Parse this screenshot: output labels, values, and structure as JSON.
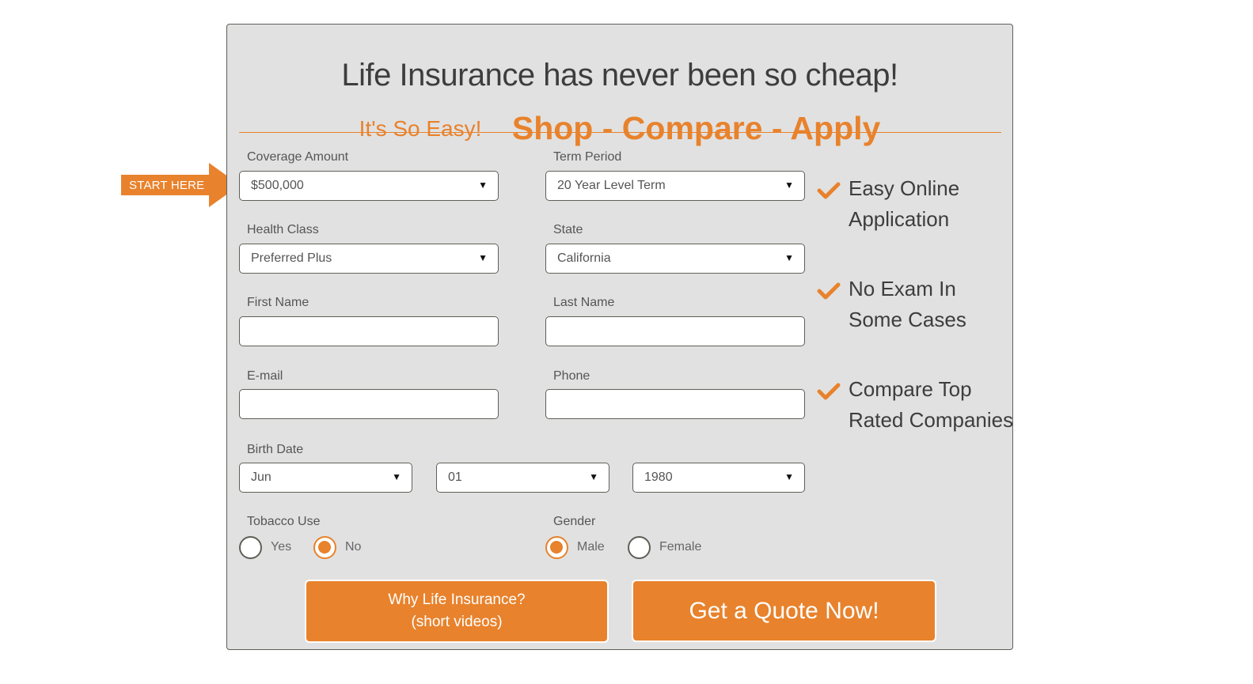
{
  "header": {
    "title": "Life Insurance has never been so cheap!",
    "tagline": "It's So Easy!",
    "steps": "Shop - Compare - Apply"
  },
  "callout": {
    "label": "START HERE",
    "icon": "arrow-right-icon"
  },
  "form": {
    "coverage": {
      "label": "Coverage Amount",
      "value": "$500,000"
    },
    "term": {
      "label": "Term Period",
      "value": "20 Year Level Term"
    },
    "health": {
      "label": "Health Class",
      "value": "Preferred Plus"
    },
    "state": {
      "label": "State",
      "value": "California"
    },
    "first_name": {
      "label": "First Name",
      "value": ""
    },
    "last_name": {
      "label": "Last Name",
      "value": ""
    },
    "email": {
      "label": "E-mail",
      "value": ""
    },
    "phone": {
      "label": "Phone",
      "value": ""
    },
    "birth_date": {
      "label": "Birth Date",
      "month": "Jun",
      "day": "01",
      "year": "1980"
    },
    "tobacco": {
      "label": "Tobacco Use",
      "options": [
        {
          "label": "Yes",
          "checked": false
        },
        {
          "label": "No",
          "checked": true
        }
      ]
    },
    "gender": {
      "label": "Gender",
      "options": [
        {
          "label": "Male",
          "checked": true
        },
        {
          "label": "Female",
          "checked": false
        }
      ]
    },
    "caret": "▼"
  },
  "buttons": {
    "why_line1": "Why Life Insurance?",
    "why_line2": "(short videos)",
    "quote": "Get a Quote Now!"
  },
  "benefits": [
    {
      "line1": "Easy Online",
      "line2": "Application",
      "icon": "checkmark-icon"
    },
    {
      "line1": "No Exam In",
      "line2": "Some Cases",
      "icon": "checkmark-icon"
    },
    {
      "line1": "Compare Top",
      "line2": "Rated Companies",
      "icon": "checkmark-icon"
    }
  ],
  "colors": {
    "accent": "#e8822c",
    "panel": "#e1e1e1",
    "border": "#5f5f58",
    "text": "#3d3d3d"
  }
}
